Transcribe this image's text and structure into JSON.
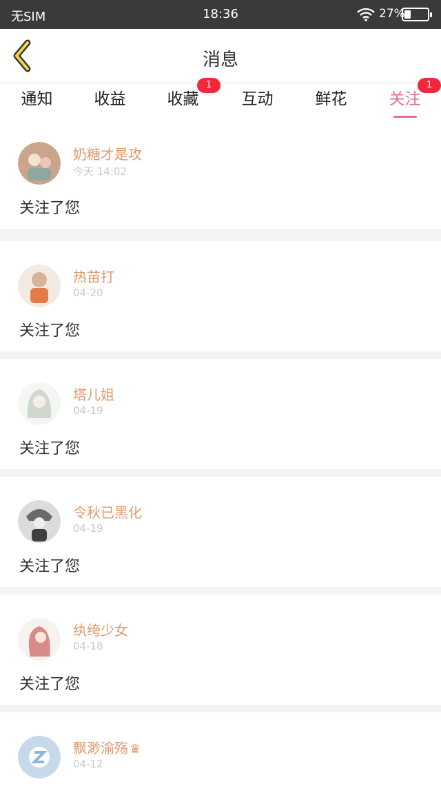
{
  "status_bar": {
    "carrier": "无SIM",
    "time": "18:36",
    "battery_percent": "27%",
    "battery_level": 0.27,
    "icons": [
      "wifi-icon",
      "battery-icon"
    ]
  },
  "header": {
    "title": "消息",
    "back_icon": "chevron-left-icon",
    "accent_color": "#e0708e"
  },
  "tabs": [
    {
      "label": "通知",
      "badge": null,
      "active": false
    },
    {
      "label": "收益",
      "badge": null,
      "active": false
    },
    {
      "label": "收藏",
      "badge": "1",
      "active": false
    },
    {
      "label": "互动",
      "badge": null,
      "active": false
    },
    {
      "label": "鲜花",
      "badge": null,
      "active": false
    },
    {
      "label": "关注",
      "badge": "1",
      "active": true
    }
  ],
  "messages": [
    {
      "name": "奶糖才是攻",
      "time": "今天 14:02",
      "text": "关注了您",
      "avatar_color": "#c9a58d"
    },
    {
      "name": "热苗打",
      "time": "04-20",
      "text": "关注了您",
      "avatar_color": "#d4b49a"
    },
    {
      "name": "塔儿姐",
      "time": "04-19",
      "text": "关注了您",
      "avatar_color": "#cfd8cf"
    },
    {
      "name": "令秋已黑化",
      "time": "04-19",
      "text": "关注了您",
      "avatar_color": "#6a6a6a"
    },
    {
      "name": "纨绔少女",
      "time": "04-18",
      "text": "关注了您",
      "avatar_color": "#d88b88"
    },
    {
      "name": "飘渺渝殇",
      "time": "04-12",
      "text": "",
      "avatar_color": "#c5d9ea",
      "crown": true
    }
  ]
}
